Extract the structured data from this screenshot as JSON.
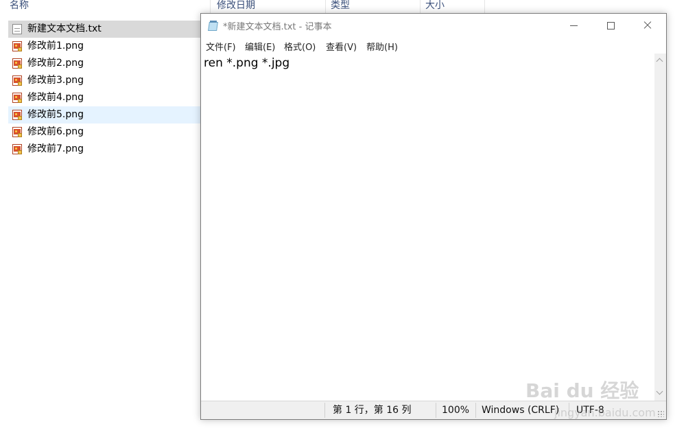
{
  "explorer": {
    "columns": [
      "名称",
      "修改日期",
      "类型",
      "大小"
    ],
    "files": [
      {
        "name": "新建文本文档.txt",
        "icon": "text-file-icon",
        "state": "selected"
      },
      {
        "name": "修改前1.png",
        "icon": "image-file-icon",
        "state": ""
      },
      {
        "name": "修改前2.png",
        "icon": "image-file-icon",
        "state": ""
      },
      {
        "name": "修改前3.png",
        "icon": "image-file-icon",
        "state": ""
      },
      {
        "name": "修改前4.png",
        "icon": "image-file-icon",
        "state": ""
      },
      {
        "name": "修改前5.png",
        "icon": "image-file-icon",
        "state": "hover"
      },
      {
        "name": "修改前6.png",
        "icon": "image-file-icon",
        "state": ""
      },
      {
        "name": "修改前7.png",
        "icon": "image-file-icon",
        "state": ""
      }
    ]
  },
  "notepad": {
    "title": "*新建文本文档.txt - 记事本",
    "menu": [
      "文件(F)",
      "编辑(E)",
      "格式(O)",
      "查看(V)",
      "帮助(H)"
    ],
    "content": "ren *.png *.jpg",
    "status": {
      "position": "第 1 行，第 16 列",
      "zoom": "100%",
      "line_ending": "Windows (CRLF)",
      "encoding": "UTF-8"
    }
  },
  "watermark": {
    "brand": "Bai du 经验",
    "url": "jingyan.baidu.com"
  },
  "colors": {
    "selected_row": "#d9d9d9",
    "hover_row": "#e5f3ff",
    "column_header_text": "#3a4f7a"
  }
}
